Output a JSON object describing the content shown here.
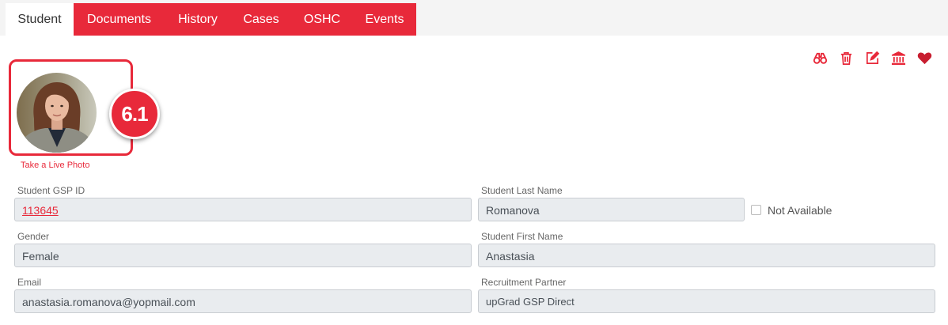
{
  "tabs": [
    {
      "label": "Student",
      "active": true
    },
    {
      "label": "Documents"
    },
    {
      "label": "History"
    },
    {
      "label": "Cases"
    },
    {
      "label": "OSHC"
    },
    {
      "label": "Events"
    }
  ],
  "toolbar": {
    "icons": [
      "binoculars-icon",
      "trash-icon",
      "edit-icon",
      "bank-icon",
      "heart-icon"
    ]
  },
  "photo": {
    "badge": "6.1",
    "live_photo_label": "Take a Live Photo"
  },
  "form": {
    "gsp_id": {
      "label": "Student GSP ID",
      "value": "113645"
    },
    "last_name": {
      "label": "Student Last Name",
      "value": "Romanova"
    },
    "not_available": {
      "label": "Not Available",
      "checked": false
    },
    "gender": {
      "label": "Gender",
      "value": "Female"
    },
    "first_name": {
      "label": "Student First Name",
      "value": "Anastasia"
    },
    "email": {
      "label": "Email",
      "value": "anastasia.romanova@yopmail.com"
    },
    "recruitment_partner": {
      "label": "Recruitment Partner",
      "value": "upGrad GSP Direct"
    }
  },
  "colors": {
    "accent": "#e8293a",
    "field_bg": "#e9ecef"
  }
}
